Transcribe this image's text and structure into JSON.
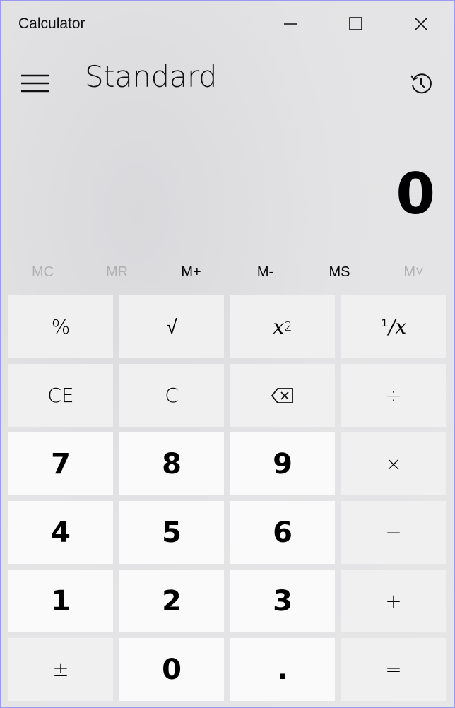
{
  "window": {
    "title": "Calculator",
    "controls": {
      "minimize": "minimize",
      "maximize": "maximize",
      "close": "close"
    }
  },
  "header": {
    "mode": "Standard",
    "menu_icon": "hamburger-icon",
    "history_icon": "history-icon"
  },
  "display": {
    "value": "0"
  },
  "memory": [
    {
      "label": "MC",
      "enabled": false
    },
    {
      "label": "MR",
      "enabled": false
    },
    {
      "label": "M+",
      "enabled": true
    },
    {
      "label": "M-",
      "enabled": true
    },
    {
      "label": "MS",
      "enabled": true
    },
    {
      "label": "M˅",
      "enabled": false
    }
  ],
  "keys": {
    "percent": "%",
    "sqrt": "√",
    "square_base": "x",
    "square_exp": "2",
    "reciprocal_num": "¹",
    "reciprocal_rest": "/x",
    "clear_entry": "CE",
    "clear": "C",
    "backspace": "backspace",
    "divide": "÷",
    "seven": "7",
    "eight": "8",
    "nine": "9",
    "multiply": "×",
    "four": "4",
    "five": "5",
    "six": "6",
    "subtract": "−",
    "one": "1",
    "two": "2",
    "three": "3",
    "add": "+",
    "negate": "±",
    "zero": "0",
    "decimal": ".",
    "equals": "="
  }
}
